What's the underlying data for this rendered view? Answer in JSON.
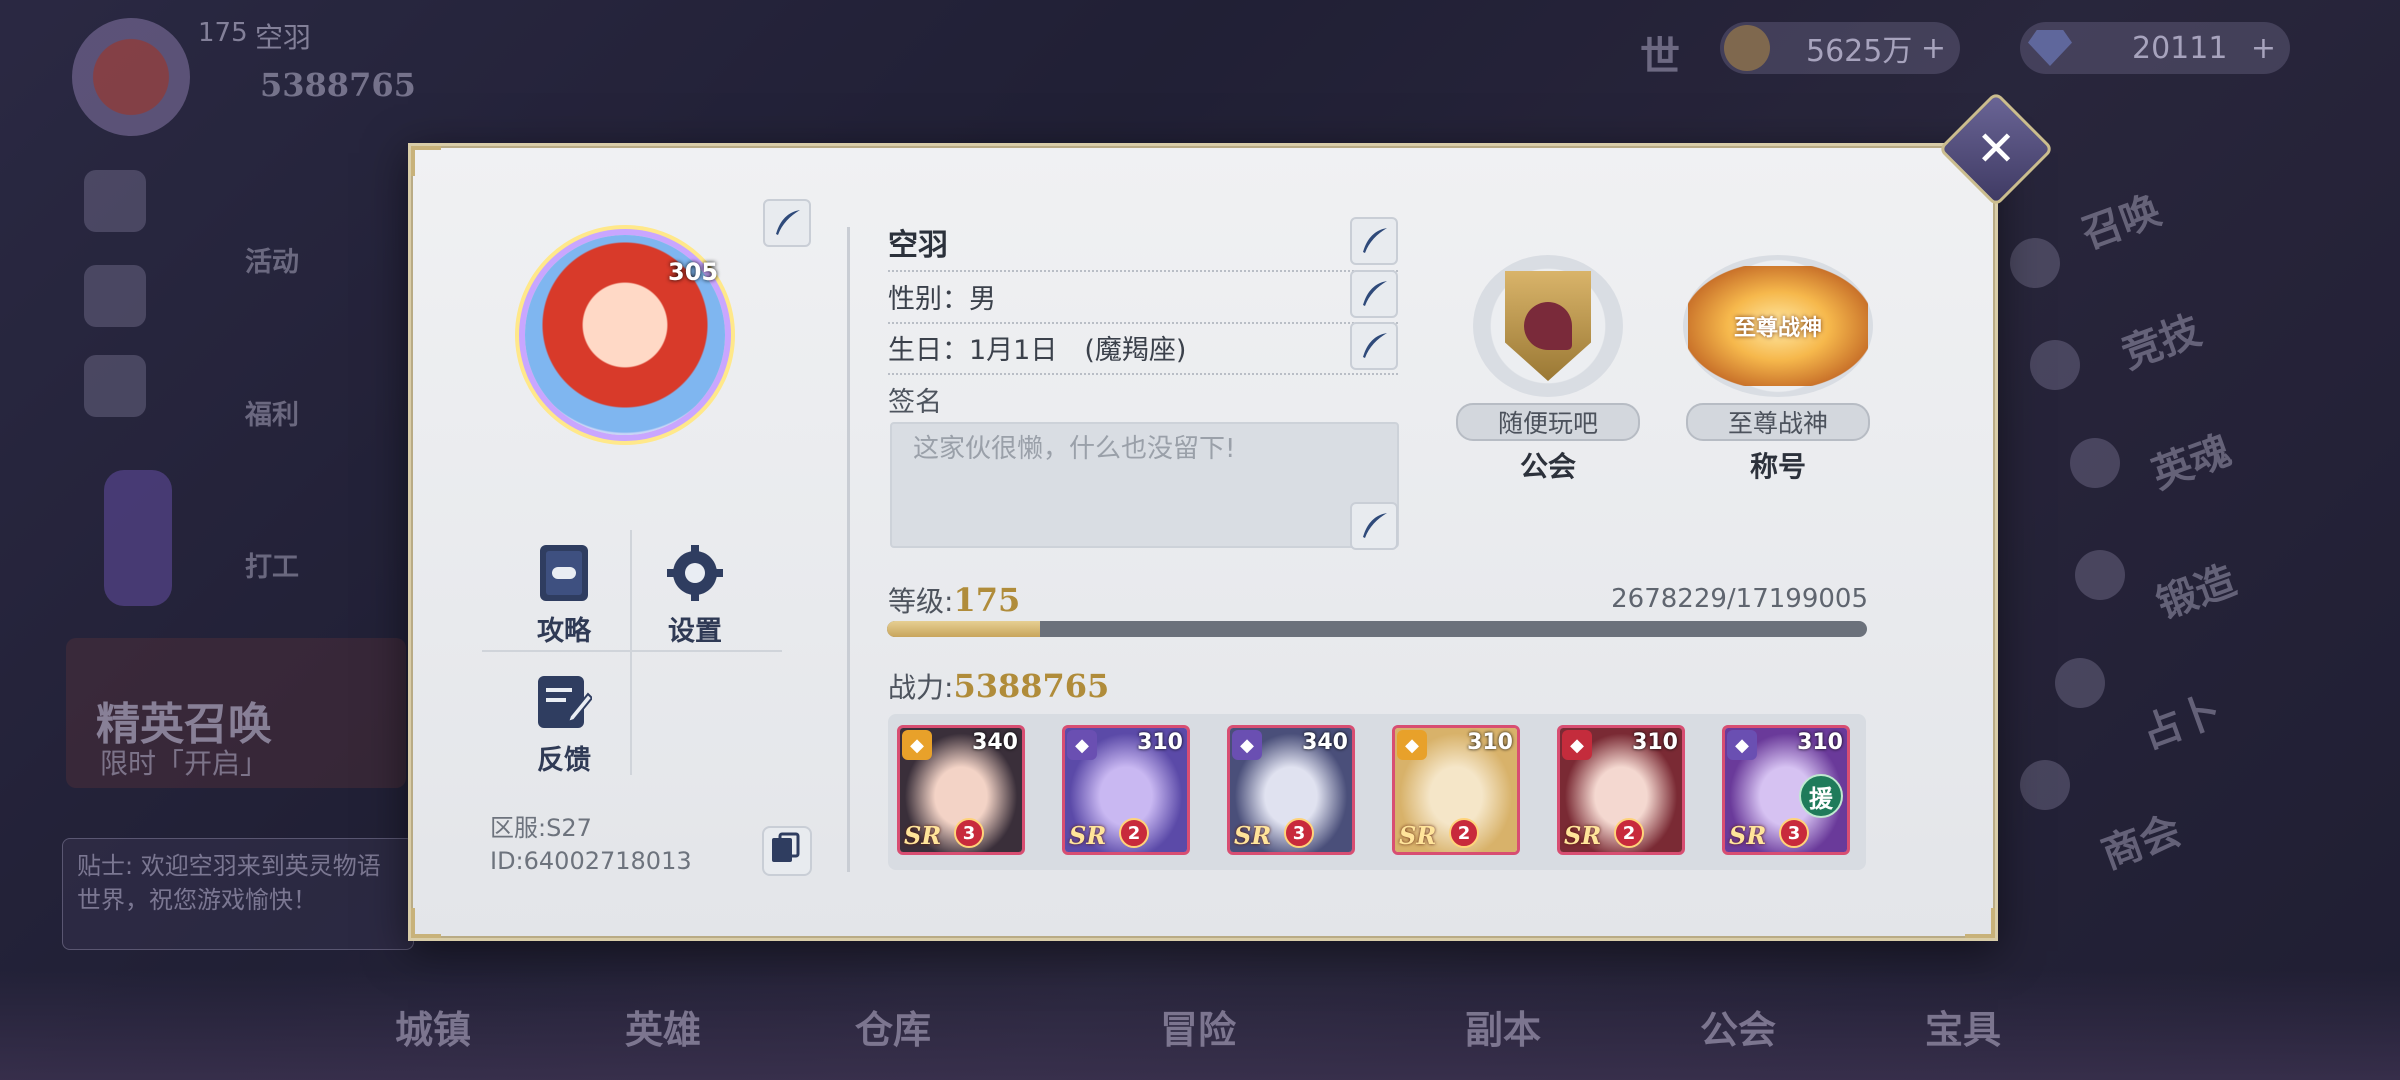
{
  "background": {
    "player_level": "175",
    "player_name": "空羽",
    "player_power": "5388765",
    "gold": "5625万",
    "gems": "20111",
    "world_icon": "世",
    "left_menu": [
      "活动",
      "福利",
      "打工"
    ],
    "event_title": "精英召唤",
    "event_subtitle": "限时「开启」",
    "tip_text": "贴士: 欢迎空羽来到英灵物语世界，祝您游戏愉快！",
    "right_menu": [
      "召唤",
      "竞技",
      "英魂",
      "锻造",
      "占卜",
      "商会"
    ],
    "bottom_nav": [
      "城镇",
      "英雄",
      "仓库",
      "冒险",
      "副本",
      "公会",
      "宝具"
    ]
  },
  "dialog": {
    "close_icon": "✕",
    "avatar_level": "305",
    "menu": {
      "guide_label": "攻略",
      "settings_label": "设置",
      "feedback_label": "反馈"
    },
    "server": "区服:S27",
    "user_id": "ID:64002718013",
    "profile": {
      "name": "空羽",
      "gender": "性别：男",
      "birthday": "生日：1月1日　(魔羯座)",
      "signature_label": "签名",
      "signature_placeholder": "这家伙很懒，什么也没留下!"
    },
    "guild": {
      "name": "随便玩吧",
      "caption": "公会"
    },
    "title": {
      "emblem_text": "至尊战神",
      "name": "至尊战神",
      "caption": "称号"
    },
    "level_label": "等级:",
    "level_value": "175",
    "exp_text": "2678229/17199005",
    "exp_progress": 0.1557,
    "power_label": "战力:",
    "power_value": "5388765",
    "team": [
      {
        "level": "340",
        "rank": "SR",
        "stars": "3",
        "element": "sun",
        "element_color": "#e8a12a",
        "art": [
          "#3a2f3a",
          "#f3d3c6"
        ],
        "assist": ""
      },
      {
        "level": "310",
        "rank": "SR",
        "stars": "2",
        "element": "moon",
        "element_color": "#6a4fb2",
        "art": [
          "#5b4aa8",
          "#c9b8f2"
        ],
        "assist": ""
      },
      {
        "level": "340",
        "rank": "SR",
        "stars": "3",
        "element": "moon",
        "element_color": "#6a4fb2",
        "art": [
          "#4a4f7a",
          "#e0e2f0"
        ],
        "assist": ""
      },
      {
        "level": "310",
        "rank": "SR",
        "stars": "2",
        "element": "sun",
        "element_color": "#e8a12a",
        "art": [
          "#d8b26a",
          "#f5e6c8"
        ],
        "assist": ""
      },
      {
        "level": "310",
        "rank": "SR",
        "stars": "2",
        "element": "fire",
        "element_color": "#c42c3c",
        "art": [
          "#7a2a34",
          "#f4d8d0"
        ],
        "assist": ""
      },
      {
        "level": "310",
        "rank": "SR",
        "stars": "3",
        "element": "moon",
        "element_color": "#6a4fb2",
        "art": [
          "#6a3a9a",
          "#d6c2f2"
        ],
        "assist": "援"
      }
    ]
  }
}
